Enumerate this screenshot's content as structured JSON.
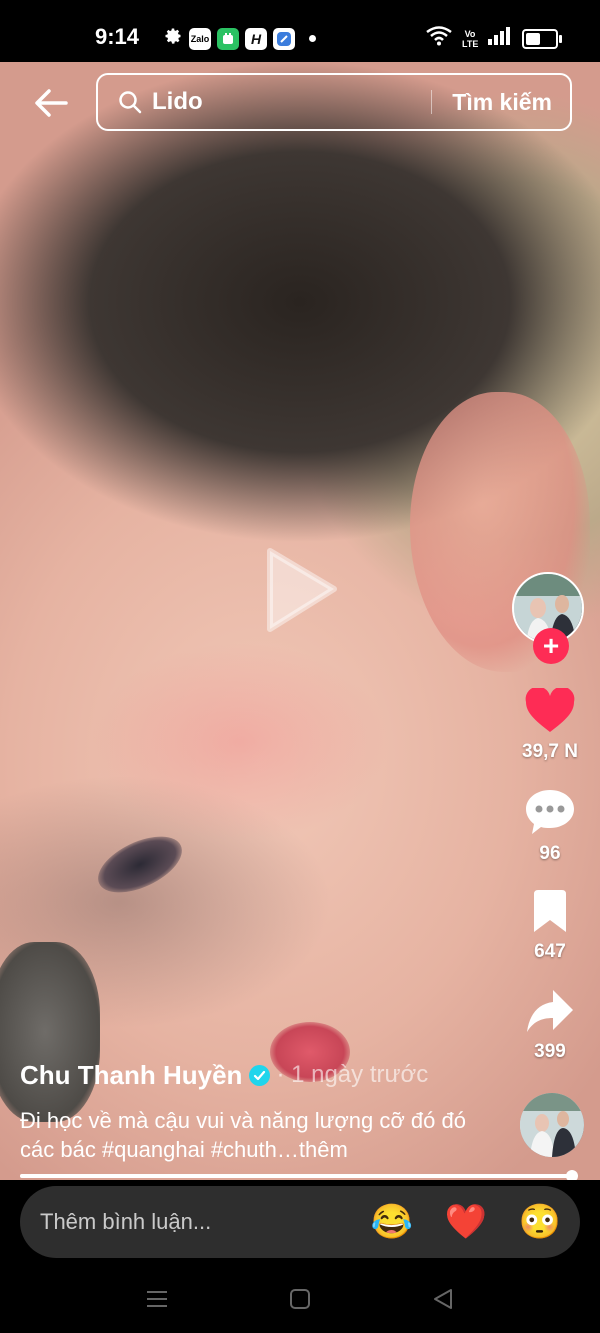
{
  "status_bar": {
    "time": "9:14",
    "left_icons": [
      "settings-icon",
      "zalo-icon",
      "app-icon",
      "h-app-icon",
      "browser-icon",
      "dot"
    ],
    "right_icons": [
      "wifi-icon",
      "volte-icon",
      "signal-icon",
      "battery-icon"
    ],
    "volte_label": "Vo LTE",
    "zalo_label": "Zalo",
    "h_label": "H",
    "battery_level": 0.6
  },
  "header": {
    "search_query": "Lido",
    "search_button": "Tìm kiếm"
  },
  "video": {
    "progress": 1.0
  },
  "right_rail": {
    "likes": "39,7 N",
    "comments": "96",
    "saves": "647",
    "shares": "399"
  },
  "post": {
    "username": "Chu Thanh Huyền",
    "time": "· 1 ngày trước",
    "caption": "Đi học về mà cậu vui và năng lượng cỡ đó đó các bác #quanghai #chuth…thêm"
  },
  "comment_bar": {
    "placeholder": "Thêm bình luận...",
    "emojis": [
      "😂",
      "❤️",
      "😳"
    ]
  },
  "colors": {
    "accent": "#fe2c55",
    "like": "#fe2c55",
    "verified": "#20d5ec"
  }
}
